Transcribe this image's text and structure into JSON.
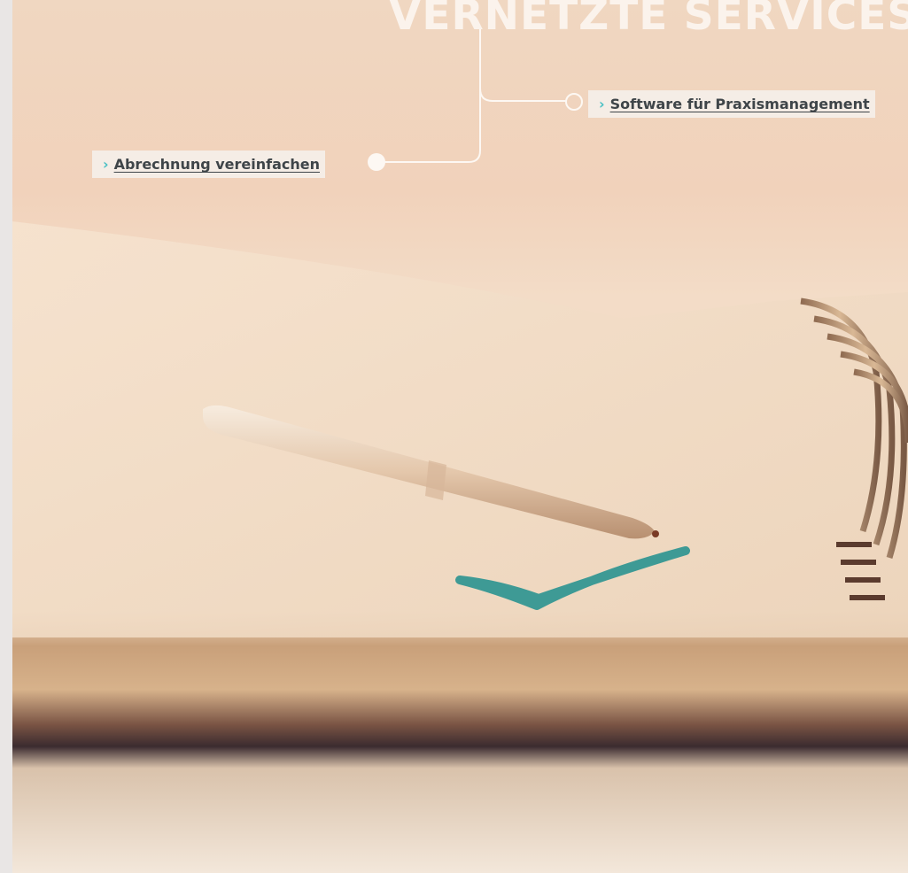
{
  "hero": {
    "title": "VERNETZTE SERVICES",
    "image_description": "notebook-with-pen-and-checkmark"
  },
  "links": [
    {
      "label": "Abrechnung vereinfachen",
      "icon": "chevron-right-icon"
    },
    {
      "label": "Software für Praxismanagement",
      "icon": "chevron-right-icon"
    }
  ],
  "colors": {
    "accent": "#4ac0c4",
    "link_text": "#3f4549",
    "tag_bg": "#f5ede6",
    "title": "#fbf3ec",
    "connector": "#fdf8f3"
  }
}
